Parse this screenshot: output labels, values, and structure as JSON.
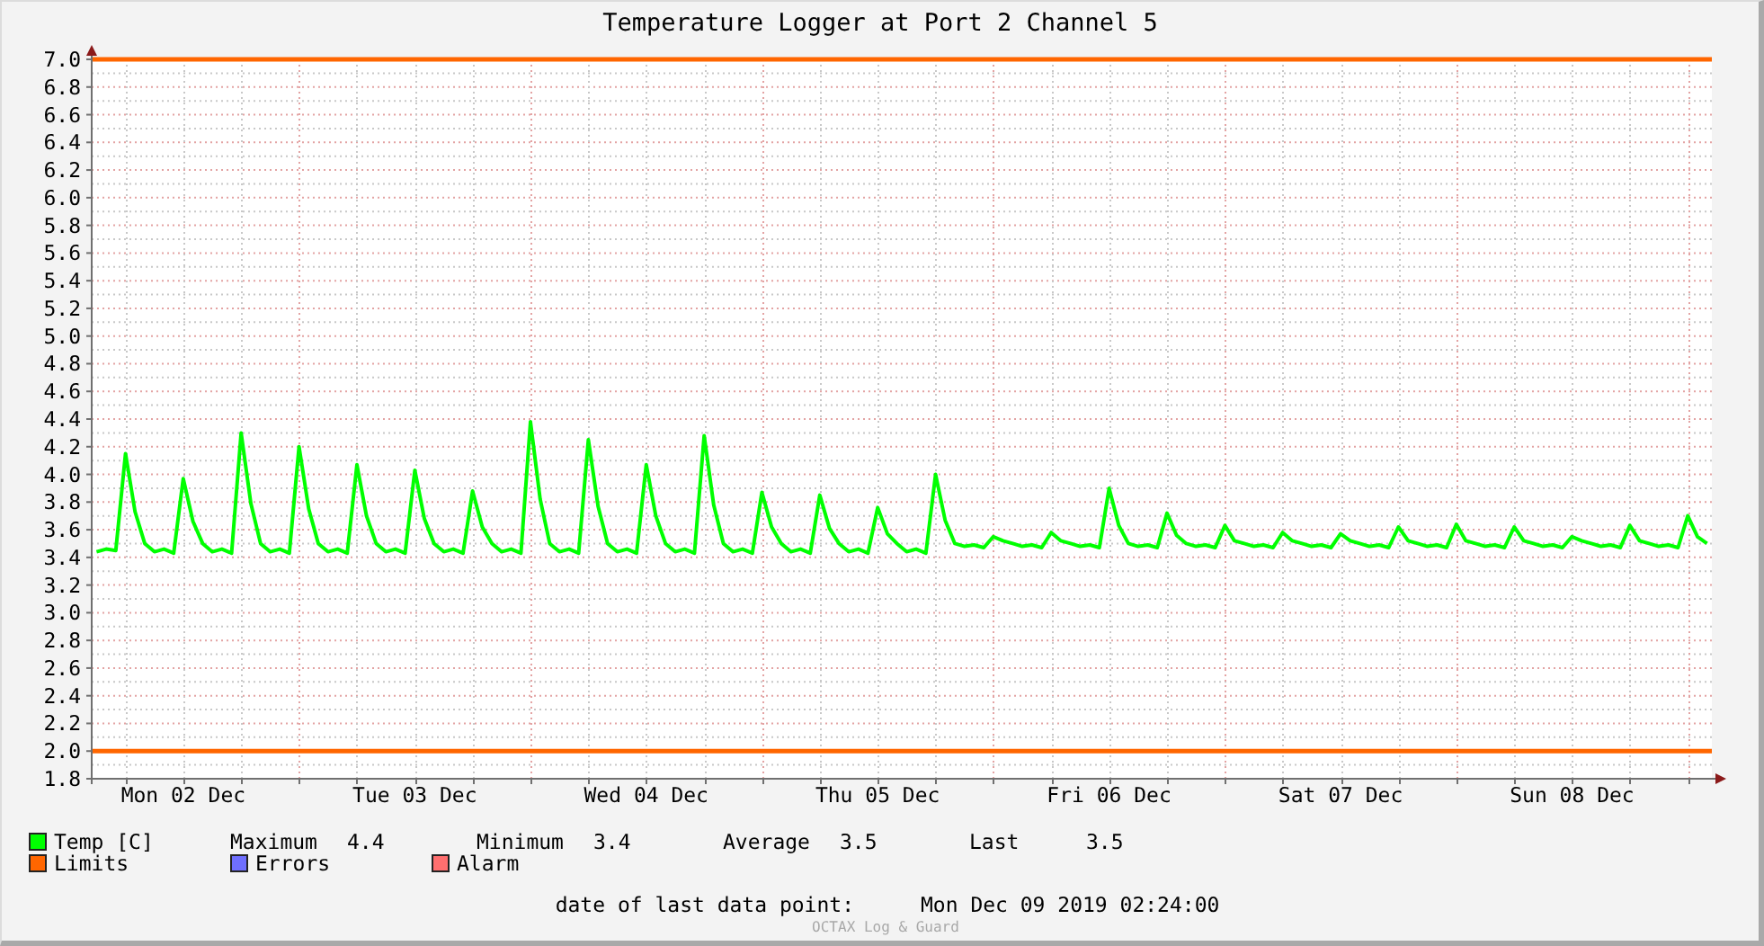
{
  "title": "Temperature Logger at Port 2 Channel 5",
  "chart_data": {
    "type": "line",
    "categories": [
      null,
      null,
      null,
      null,
      null,
      null,
      null,
      null,
      null,
      "Mon 02 Dec",
      null,
      null,
      null,
      null,
      null,
      null,
      null,
      null,
      null,
      null,
      null,
      null,
      null,
      null,
      null,
      null,
      null,
      null,
      null,
      null,
      null,
      null,
      null,
      "Tue 03 Dec",
      null,
      null,
      null,
      null,
      null,
      null,
      null,
      null,
      null,
      null,
      null,
      null,
      null,
      null,
      null,
      null,
      null,
      null,
      null,
      null,
      null,
      null,
      null,
      "Wed 04 Dec",
      null,
      null,
      null,
      null,
      null,
      null,
      null,
      null,
      null,
      null,
      null,
      null,
      null,
      null,
      null,
      null,
      null,
      null,
      null,
      null,
      null,
      null,
      null,
      "Thu 05 Dec",
      null,
      null,
      null,
      null,
      null,
      null,
      null,
      null,
      null,
      null,
      null,
      null,
      null,
      null,
      null,
      null,
      null,
      null,
      null,
      null,
      null,
      null,
      null,
      "Fri 06 Dec",
      null,
      null,
      null,
      null,
      null,
      null,
      null,
      null,
      null,
      null,
      null,
      null,
      null,
      null,
      null,
      null,
      null,
      null,
      null,
      null,
      null,
      null,
      null,
      "Sat 07 Dec",
      null,
      null,
      null,
      null,
      null,
      null,
      null,
      null,
      null,
      null,
      null,
      null,
      null,
      null,
      null,
      null,
      null,
      null,
      null,
      null,
      null,
      null,
      null,
      "Sun 08 Dec",
      null,
      null,
      null,
      null,
      null,
      null,
      null,
      null,
      null,
      null,
      null,
      null,
      null,
      null
    ],
    "series": [
      {
        "name": "Temp [C]",
        "color": "#00ff00",
        "values": [
          3.44,
          3.46,
          3.45,
          4.15,
          3.73,
          3.5,
          3.44,
          3.46,
          3.43,
          3.97,
          3.66,
          3.5,
          3.44,
          3.46,
          3.43,
          4.3,
          3.79,
          3.5,
          3.44,
          3.46,
          3.43,
          4.2,
          3.75,
          3.5,
          3.44,
          3.46,
          3.43,
          4.07,
          3.7,
          3.5,
          3.44,
          3.46,
          3.43,
          4.03,
          3.68,
          3.5,
          3.44,
          3.46,
          3.43,
          3.88,
          3.62,
          3.5,
          3.44,
          3.46,
          3.43,
          4.38,
          3.82,
          3.5,
          3.44,
          3.46,
          3.43,
          4.25,
          3.77,
          3.5,
          3.44,
          3.46,
          3.43,
          4.07,
          3.7,
          3.5,
          3.44,
          3.46,
          3.43,
          4.28,
          3.78,
          3.5,
          3.44,
          3.46,
          3.43,
          3.87,
          3.62,
          3.5,
          3.44,
          3.46,
          3.43,
          3.85,
          3.61,
          3.5,
          3.44,
          3.46,
          3.43,
          3.76,
          3.57,
          3.5,
          3.44,
          3.46,
          3.43,
          4.0,
          3.67,
          3.5,
          3.48,
          3.49,
          3.47,
          3.55,
          3.52,
          3.5,
          3.48,
          3.49,
          3.47,
          3.58,
          3.52,
          3.5,
          3.48,
          3.49,
          3.47,
          3.9,
          3.63,
          3.5,
          3.48,
          3.49,
          3.47,
          3.72,
          3.56,
          3.5,
          3.48,
          3.49,
          3.47,
          3.63,
          3.52,
          3.5,
          3.48,
          3.49,
          3.47,
          3.58,
          3.52,
          3.5,
          3.48,
          3.49,
          3.47,
          3.57,
          3.52,
          3.5,
          3.48,
          3.49,
          3.47,
          3.62,
          3.52,
          3.5,
          3.48,
          3.49,
          3.47,
          3.64,
          3.52,
          3.5,
          3.48,
          3.49,
          3.47,
          3.62,
          3.52,
          3.5,
          3.48,
          3.49,
          3.47,
          3.55,
          3.52,
          3.5,
          3.48,
          3.49,
          3.47,
          3.63,
          3.52,
          3.5,
          3.48,
          3.49,
          3.47,
          3.7,
          3.55,
          3.5
        ]
      }
    ],
    "ylim": [
      1.8,
      7.0
    ],
    "yticks": [
      {
        "value": 1.8,
        "label": "1.8"
      },
      {
        "value": 2.0,
        "label": "2.0"
      },
      {
        "value": 2.2,
        "label": "2.2"
      },
      {
        "value": 2.4,
        "label": "2.4"
      },
      {
        "value": 2.6,
        "label": "2.6"
      },
      {
        "value": 2.8,
        "label": "2.8"
      },
      {
        "value": 3.0,
        "label": "3.0"
      },
      {
        "value": 3.2,
        "label": "3.2"
      },
      {
        "value": 3.4,
        "label": "3.4"
      },
      {
        "value": 3.6,
        "label": "3.6"
      },
      {
        "value": 3.8,
        "label": "3.8"
      },
      {
        "value": 4.0,
        "label": "4.0"
      },
      {
        "value": 4.2,
        "label": "4.2"
      },
      {
        "value": 4.4,
        "label": "4.4"
      },
      {
        "value": 4.6,
        "label": "4.6"
      },
      {
        "value": 4.8,
        "label": "4.8"
      },
      {
        "value": 5.0,
        "label": "5.0"
      },
      {
        "value": 5.2,
        "label": "5.2"
      },
      {
        "value": 5.4,
        "label": "5.4"
      },
      {
        "value": 5.6,
        "label": "5.6"
      },
      {
        "value": 5.8,
        "label": "5.8"
      },
      {
        "value": 6.0,
        "label": "6.0"
      },
      {
        "value": 6.2,
        "label": "6.2"
      },
      {
        "value": 6.4,
        "label": "6.4"
      },
      {
        "value": 6.6,
        "label": "6.6"
      },
      {
        "value": 6.8,
        "label": "6.8"
      },
      {
        "value": 7.0,
        "label": "7.0"
      }
    ],
    "grid": true,
    "ref_lines": [
      {
        "axis": "y",
        "value": 7.0,
        "color": "#ff6600"
      },
      {
        "axis": "y",
        "value": 2.0,
        "color": "#ff6600"
      }
    ]
  },
  "legend": [
    {
      "label": "Limits",
      "color": "#ff6600"
    },
    {
      "label": "Errors",
      "color": "#6f6fff"
    },
    {
      "label": "Alarm",
      "color": "#ff6f6f"
    }
  ],
  "stats": [
    {
      "label": "Maximum",
      "value": "4.4"
    },
    {
      "label": "Minimum",
      "value": "3.4"
    },
    {
      "label": "Average",
      "value": "3.5"
    },
    {
      "label": "Last",
      "value": "3.5"
    }
  ],
  "last_data_point": {
    "label": "date of last data point:",
    "value": "Mon Dec 09 2019 02:24:00"
  },
  "watermark": "OCTAX Log & Guard"
}
